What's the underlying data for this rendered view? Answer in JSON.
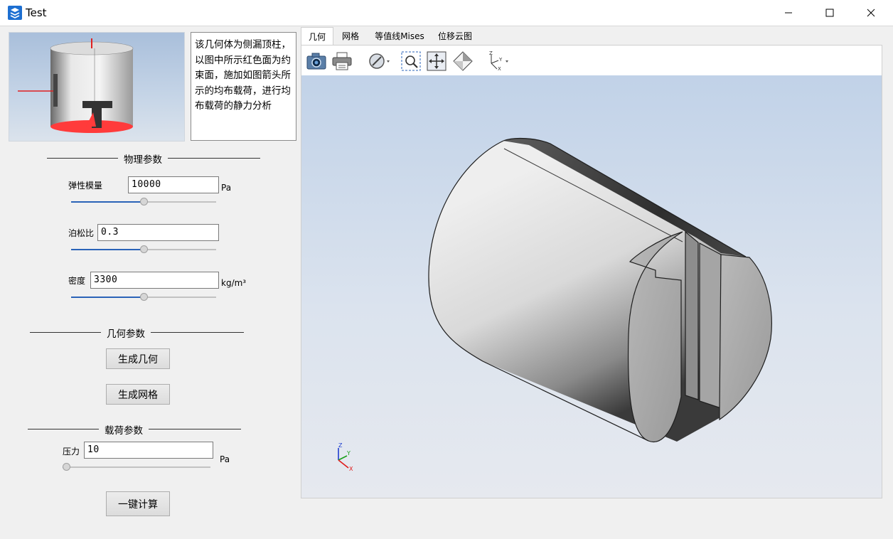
{
  "window": {
    "title": "Test",
    "icon": "app-icon"
  },
  "description": "该几何体为侧漏顶柱，以图中所示红色面为约束面，施加如图箭头所示的均布载荷，进行均布载荷的静力分析",
  "physics": {
    "title": "物理参数",
    "elastic_label": "弹性模量",
    "elastic_value": "10000",
    "elastic_unit": "Pa",
    "elastic_level": 0.5,
    "poisson_label": "泊松比",
    "poisson_value": "0.3",
    "poisson_level": 0.5,
    "density_label": "密度",
    "density_value": "3300",
    "density_unit": "kg/m³",
    "density_level": 0.5
  },
  "geometry": {
    "title": "几何参数",
    "gen_geometry_label": "生成几何",
    "gen_mesh_label": "生成网格"
  },
  "load": {
    "title": "载荷参数",
    "pressure_label": "压力",
    "pressure_value": "10",
    "pressure_unit": "Pa",
    "pressure_level": 0.0,
    "compute_label": "一键计算"
  },
  "tabs": [
    "几何",
    "网格",
    "等值线Mises",
    "位移云图"
  ],
  "active_tab": 0,
  "toolbar_icons": [
    "camera-icon",
    "print-icon",
    "display-mode-icon",
    "zoom-box-icon",
    "fit-all-icon",
    "view-iso-icon",
    "axes-view-icon"
  ],
  "triad": {
    "z": "Z",
    "y": "Y",
    "x": "X"
  },
  "colors": {
    "constraint_face": "#ff3b3b",
    "slider_fill": "#2a63b8",
    "viewer_bg_top": "#c1d2e8",
    "viewer_bg_bottom": "#e6e9ef"
  }
}
